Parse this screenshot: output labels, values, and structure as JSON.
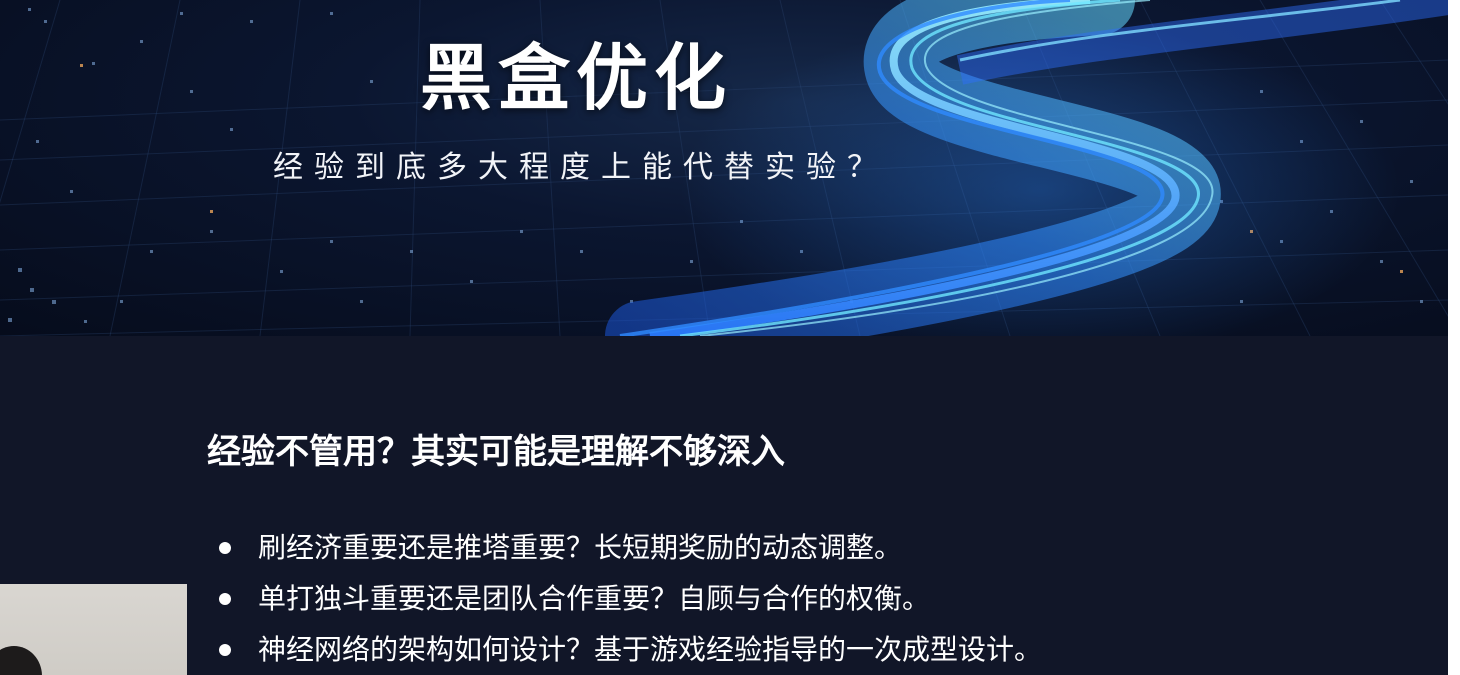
{
  "banner": {
    "title": "黑盒优化",
    "subtitle": "经验到底多大程度上能代替实验？"
  },
  "content": {
    "heading": "经验不管用？其实可能是理解不够深入",
    "bullets": [
      "刷经济重要还是推塔重要？长短期奖励的动态调整。",
      "单打独斗重要还是团队合作重要？自顾与合作的权衡。",
      "神经网络的架构如何设计？基于游戏经验指导的一次成型设计。"
    ]
  },
  "colors": {
    "slide_background": "#111628",
    "banner_background": "#0b1630",
    "accent_blue": "#2f8bff",
    "accent_cyan": "#5ee0ff",
    "text": "#ffffff"
  },
  "icons": {
    "bullet": "bullet-dot",
    "banner_art": "glowing-light-ribbon"
  }
}
